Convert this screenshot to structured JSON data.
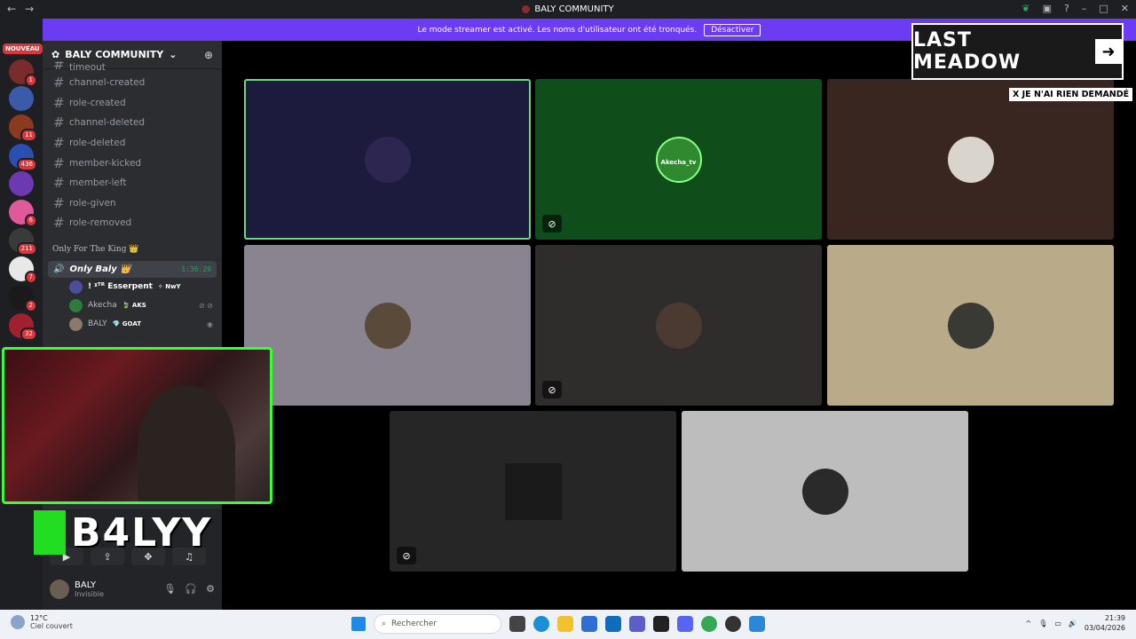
{
  "window": {
    "title": "BALY COMMUNITY",
    "nav_back": "←",
    "nav_forward": "→"
  },
  "rail": {
    "new_badge": "NOUVEAU",
    "badges": [
      "1",
      "11",
      "436",
      "6",
      "211",
      "7",
      "2",
      "32"
    ]
  },
  "banner": {
    "text": "Le mode streamer est activé. Les noms d'utilisateur ont été tronqués.",
    "button": "Désactiver"
  },
  "sidebar": {
    "server_name": "BALY COMMUNITY",
    "channels": [
      "timeout",
      "channel-created",
      "role-created",
      "channel-deleted",
      "role-deleted",
      "member-kicked",
      "member-left",
      "role-given",
      "role-removed"
    ],
    "category": "Only For The King 👑",
    "voice_channel": {
      "name": "Only Baly 👑",
      "time": "1:36:29"
    },
    "voice_users": [
      {
        "name": "! ᵡᵀᴿ Esserpent",
        "tag": "✧ NwY"
      },
      {
        "name": "Akecha",
        "tag": "🍃 AKS"
      },
      {
        "name": "BALY",
        "tag": "💎 GOAT"
      }
    ],
    "user": {
      "name": "BALY",
      "status": "Invisible"
    }
  },
  "stage": {
    "tile_label": "Akecha_tv"
  },
  "overlay": {
    "title": "LAST MEADOW",
    "arrow": "➜",
    "sub": "X JE N'AI RIEN DEMANDÉ"
  },
  "stream": {
    "name": "B4LYY"
  },
  "taskbar": {
    "weather_temp": "12°C",
    "weather_desc": "Ciel couvert",
    "search": "Rechercher",
    "time": "21:39",
    "date": "03/04/2026"
  }
}
